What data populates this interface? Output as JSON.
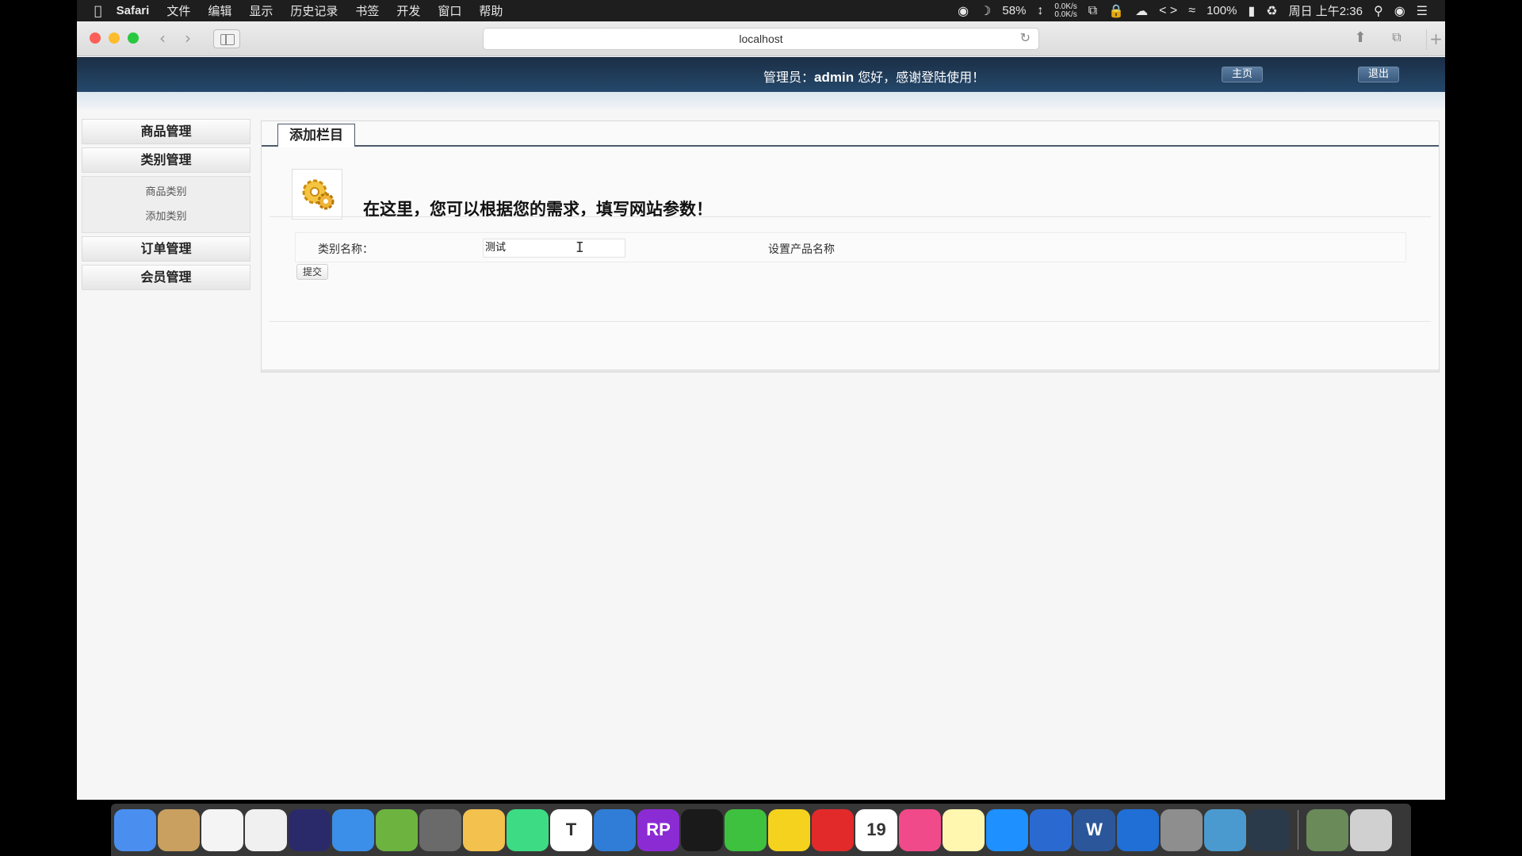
{
  "menubar": {
    "app_name": "Safari",
    "items": [
      "文件",
      "编辑",
      "显示",
      "历史记录",
      "书签",
      "开发",
      "窗口",
      "帮助"
    ],
    "battery_level": "58%",
    "net_up": "0.0K/s",
    "net_down": "0.0K/s",
    "battery_percent": "100%",
    "clock": "周日 上午2:36"
  },
  "browser": {
    "url": "localhost"
  },
  "header": {
    "admin_prefix": "管理员：",
    "admin_name": "admin",
    "admin_suffix": " 您好，感谢登陆使用！",
    "home_button": "主页",
    "logout_button": "退出"
  },
  "left_nav": {
    "items": [
      "商品管理",
      "类别管理",
      "订单管理",
      "会员管理"
    ],
    "sub_items": [
      "商品类别",
      "添加类别"
    ]
  },
  "main": {
    "tab_label": "添加栏目",
    "intro_text": "在这里，您可以根据您的需求，填写网站参数！",
    "field_label": "类别名称：",
    "field_value": "测试",
    "field_hint": "设置产品名称",
    "submit_label": "提交"
  },
  "dock": {
    "apps": [
      {
        "name": "finder",
        "color": "#4a8ff0"
      },
      {
        "name": "contacts",
        "color": "#c9a060"
      },
      {
        "name": "reminders",
        "color": "#f4f4f4"
      },
      {
        "name": "photos",
        "color": "#f0f0f0"
      },
      {
        "name": "intellij",
        "color": "#2a2a6a"
      },
      {
        "name": "safari",
        "color": "#3c8fe8"
      },
      {
        "name": "spring",
        "color": "#6db33f"
      },
      {
        "name": "launchpad",
        "color": "#6a6a6a"
      },
      {
        "name": "mouse-app",
        "color": "#f2c14e"
      },
      {
        "name": "android-studio",
        "color": "#3ddc84"
      },
      {
        "name": "typora",
        "color": "#ffffff"
      },
      {
        "name": "xcode",
        "color": "#2f7dd6"
      },
      {
        "name": "axure-rp",
        "color": "#8b2bd4"
      },
      {
        "name": "qq",
        "color": "#1a1a1a"
      },
      {
        "name": "wechat",
        "color": "#3ec13e"
      },
      {
        "name": "music-green",
        "color": "#f5d21e"
      },
      {
        "name": "netease-music",
        "color": "#e22a2a"
      },
      {
        "name": "calendar",
        "color": "#ffffff"
      },
      {
        "name": "itunes",
        "color": "#f14a8a"
      },
      {
        "name": "notes",
        "color": "#fff6b0"
      },
      {
        "name": "app-store",
        "color": "#1e90ff"
      },
      {
        "name": "remote-desktop",
        "color": "#2a6ad0"
      },
      {
        "name": "word",
        "color": "#2b579a"
      },
      {
        "name": "keynote",
        "color": "#1f6fd6"
      },
      {
        "name": "system-preferences",
        "color": "#8e8e8e"
      },
      {
        "name": "flow-app",
        "color": "#4a9ad0"
      },
      {
        "name": "quicktime",
        "color": "#2a3a4a"
      },
      {
        "name": "downloads",
        "color": "#6a8a5a"
      },
      {
        "name": "trash",
        "color": "#d0d0d0"
      }
    ],
    "calendar_day": "19",
    "typora_letter": "T",
    "rp_letter": "RP",
    "word_letter": "W"
  }
}
